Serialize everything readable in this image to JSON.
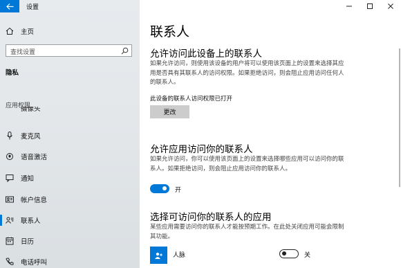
{
  "app": {
    "title": "设置"
  },
  "window_controls": {
    "minimize": "—",
    "maximize": "☐",
    "close": "✕"
  },
  "sidebar": {
    "home_label": "主页",
    "search_placeholder": "查找设置",
    "section_title": "隐私",
    "group_header": "应用权限",
    "items": [
      {
        "label": "摄像头",
        "icon": "camera-icon"
      },
      {
        "label": "麦克风",
        "icon": "microphone-icon"
      },
      {
        "label": "语音激活",
        "icon": "voice-activation-icon"
      },
      {
        "label": "通知",
        "icon": "notification-icon"
      },
      {
        "label": "帐户信息",
        "icon": "account-info-icon"
      },
      {
        "label": "联系人",
        "icon": "contacts-icon",
        "selected": true
      },
      {
        "label": "日历",
        "icon": "calendar-icon"
      },
      {
        "label": "电话呼叫",
        "icon": "phone-icon"
      }
    ]
  },
  "main": {
    "page_title": "联系人",
    "section1": {
      "heading": "允许访问此设备上的联系人",
      "description": "如果允许访问，则使用该设备的用户将可以使用该页面上的设置来选择其应用是否具有其联系人的访问权限。如果拒绝访问，则会阻止应用访问任何人的联系人。",
      "status": "此设备的联系人访问权限已打开",
      "button_label": "更改"
    },
    "section2": {
      "heading": "允许应用访问你的联系人",
      "description": "如果允许访问，你可以使用该页面上的设置来选择哪些应用可以访问你的联系人。如果拒绝访问，则会阻止应用访问你的联系人。",
      "toggle_label": "开",
      "toggle_on": true
    },
    "section3": {
      "heading": "选择可访问你的联系人的应用",
      "description": "某些应用需要访问你的联系人才能按预期工作。在此处关闭应用可能会限制其功能。",
      "apps": [
        {
          "name": "人脉",
          "toggle_label": "关",
          "toggle_on": false
        }
      ]
    }
  },
  "colors": {
    "accent": "#0078d7",
    "sidebar_bg": "#e5e9ec"
  }
}
